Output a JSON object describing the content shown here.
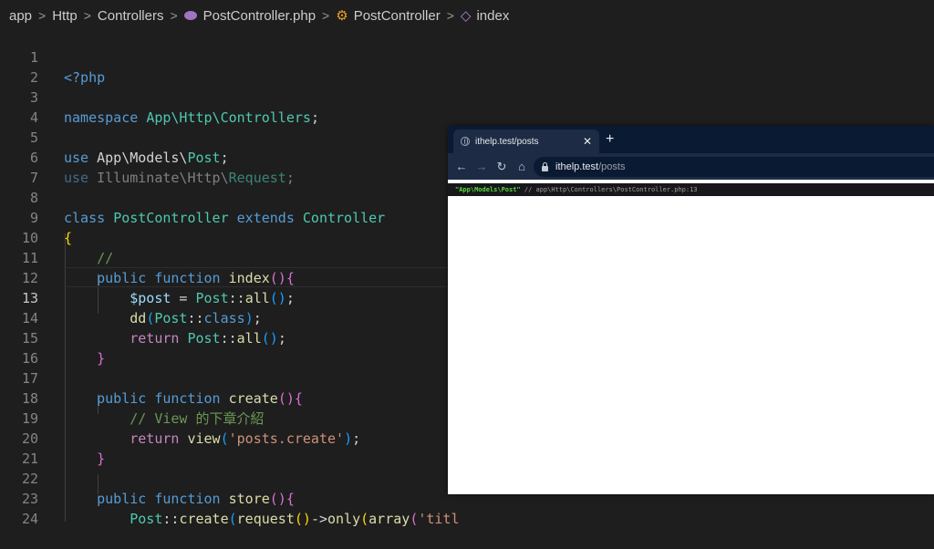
{
  "breadcrumb": {
    "items": [
      "app",
      "Http",
      "Controllers",
      "PostController.php",
      "PostController",
      "index"
    ],
    "separator": ">"
  },
  "editor": {
    "active_line": 13,
    "lines": [
      {
        "n": "1"
      },
      {
        "n": "2"
      },
      {
        "n": "3"
      },
      {
        "n": "4"
      },
      {
        "n": "5"
      },
      {
        "n": "6"
      },
      {
        "n": "7"
      },
      {
        "n": "8"
      },
      {
        "n": "9"
      },
      {
        "n": "10"
      },
      {
        "n": "11"
      },
      {
        "n": "12"
      },
      {
        "n": "13"
      },
      {
        "n": "14"
      },
      {
        "n": "15"
      },
      {
        "n": "16"
      },
      {
        "n": "17"
      },
      {
        "n": "18"
      },
      {
        "n": "19"
      },
      {
        "n": "20"
      },
      {
        "n": "21"
      },
      {
        "n": "22"
      },
      {
        "n": "23"
      },
      {
        "n": "24"
      }
    ],
    "tokens": {
      "php_open": "<?php",
      "namespace_kw": "namespace",
      "namespace_name": "App\\Http\\Controllers",
      "semi": ";",
      "use_kw": "use",
      "use_model_ns": "App\\Models\\",
      "use_model_cls": "Post",
      "use_req_ns": "Illuminate\\Http\\",
      "use_req_cls": "Request",
      "class_kw": "class",
      "class_name": "PostController",
      "extends_kw": "extends",
      "parent_name": "Controller",
      "open_brace": "{",
      "close_brace": "}",
      "comment_slash": "//",
      "public_kw": "public",
      "function_kw": "function",
      "index_fn": "index",
      "post_var": "$post",
      "equals": " = ",
      "post_cls": "Post",
      "dcolon": "::",
      "all_fn": "all",
      "dd_fn": "dd",
      "class_const": "class",
      "return_kw": "return",
      "create_fn": "create",
      "view_comment": "// View 的下章介紹",
      "view_fn": "view",
      "posts_create_str": "'posts.create'",
      "store_fn": "store",
      "request_fn": "request",
      "arrow": "->",
      "only_fn": "only",
      "array_fn": "array",
      "title_str": "'titl"
    }
  },
  "browser": {
    "tab_title": "ithelp.test/posts",
    "tab_close": "✕",
    "new_tab": "+",
    "back": "←",
    "forward": "→",
    "reload": "↻",
    "home": "⌂",
    "url_host": "ithelp.test",
    "url_path": "/posts",
    "dump_value": "\"App\\Models\\Post\"",
    "dump_note": " // app\\Http\\Controllers\\PostController.php:13"
  },
  "colors": {
    "editor_bg": "#1e1e1e",
    "keyword": "#569cd6",
    "class": "#4ec9b0",
    "function": "#dcdcaa",
    "string": "#ce9178",
    "comment": "#6a9955",
    "browser_frame": "#1d2b45",
    "dump_string": "#56db3a"
  },
  "icons": {
    "php_file": "php-elephant-icon",
    "class_symbol": "class-symbol-icon",
    "method_symbol": "method-cube-icon"
  }
}
